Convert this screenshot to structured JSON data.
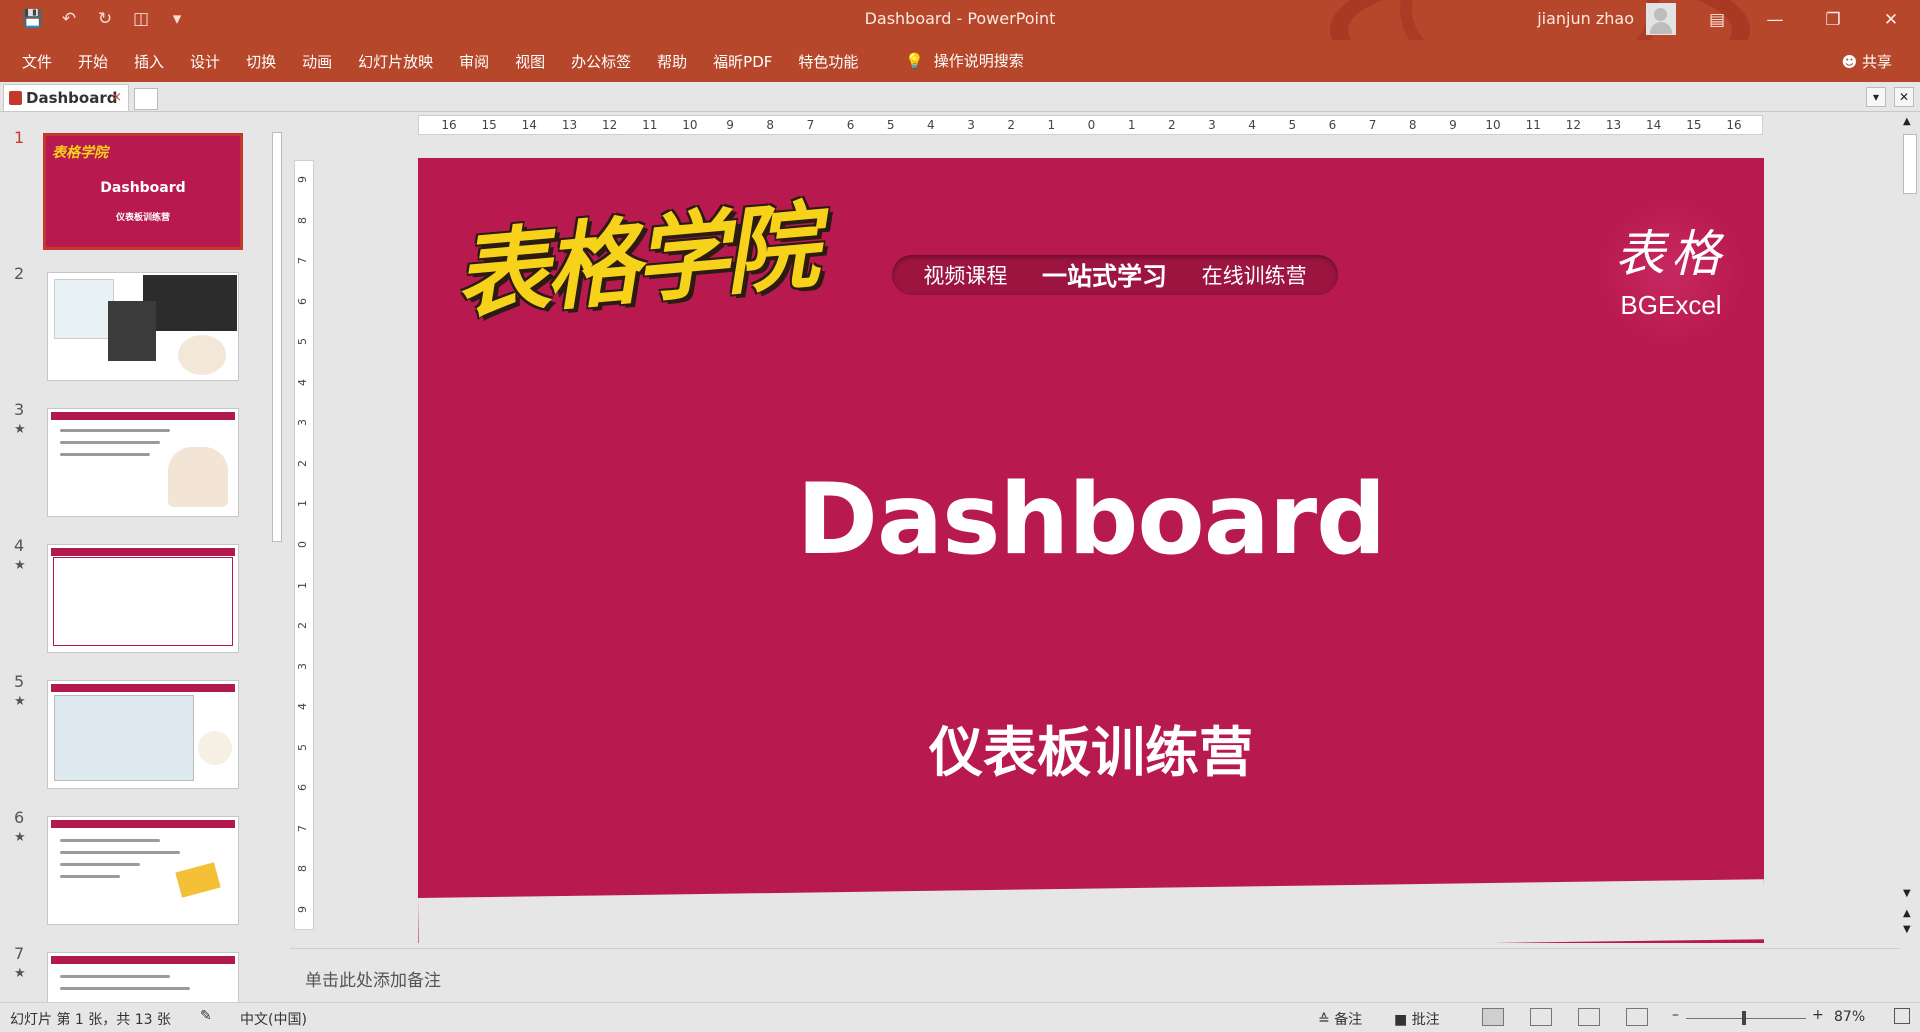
{
  "window": {
    "title": "Dashboard  -  PowerPoint",
    "user": "jianjun zhao"
  },
  "ribbon": {
    "tabs": [
      "文件",
      "开始",
      "插入",
      "设计",
      "切换",
      "动画",
      "幻灯片放映",
      "审阅",
      "视图",
      "办公标签",
      "帮助",
      "福昕PDF",
      "特色功能"
    ],
    "tell_me": "操作说明搜索",
    "share": "共享"
  },
  "doc_tab": {
    "label": "Dashboard",
    "close": "×"
  },
  "thumbnails": {
    "numbers": [
      "1",
      "2",
      "3",
      "4",
      "5",
      "6",
      "7"
    ],
    "selected": "1",
    "thumb1_title": "Dashboard",
    "thumb1_sub": "仪表板训练营"
  },
  "ruler": {
    "h_labels": [
      "16",
      "15",
      "14",
      "13",
      "12",
      "11",
      "10",
      "9",
      "8",
      "7",
      "6",
      "5",
      "4",
      "3",
      "2",
      "1",
      "0",
      "1",
      "2",
      "3",
      "4",
      "5",
      "6",
      "7",
      "8",
      "9",
      "10",
      "11",
      "12",
      "13",
      "14",
      "15",
      "16"
    ],
    "v_labels": [
      "9",
      "8",
      "7",
      "6",
      "5",
      "4",
      "3",
      "2",
      "1",
      "0",
      "1",
      "2",
      "3",
      "4",
      "5",
      "6",
      "7",
      "8",
      "9"
    ]
  },
  "slide": {
    "logo_left": "表格学院",
    "pill": [
      "视频课程",
      "一站式学习",
      "在线训练营"
    ],
    "seal_cn": "表格",
    "seal_en": "BGExcel",
    "title": "Dashboard",
    "subtitle": "仪表板训练营",
    "background_color": "#b81a4f"
  },
  "notes_placeholder": "单击此处添加备注",
  "status": {
    "slide_info": "幻灯片 第 1 张，共 13 张",
    "language": "中文(中国)",
    "notes": "备注",
    "comments": "批注",
    "zoom": "87%"
  },
  "colors": {
    "accent": "#b7472a",
    "slide": "#b81a4f",
    "logo_yellow": "#f7d21b"
  }
}
